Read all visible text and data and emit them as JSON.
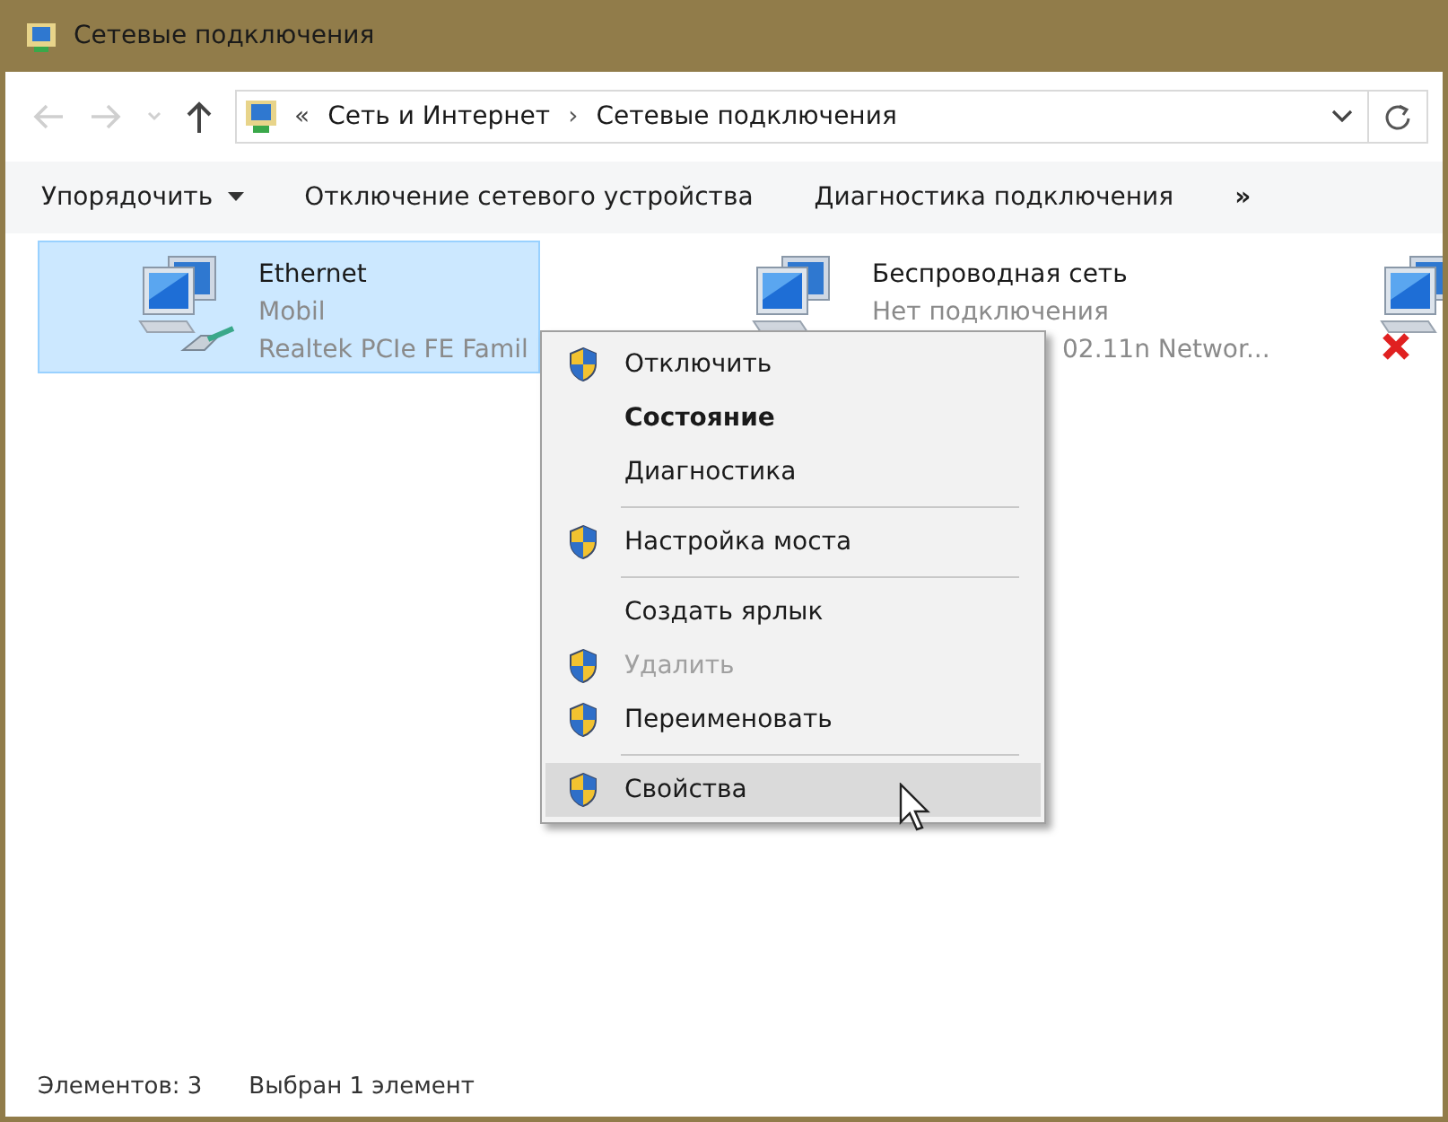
{
  "window": {
    "title": "Сетевые подключения"
  },
  "address_bar": {
    "overflow": "«",
    "path": [
      {
        "label": "Сеть и Интернет",
        "separator": "›"
      },
      {
        "label": "Сетевые подключения"
      }
    ]
  },
  "command_bar": {
    "items": [
      {
        "label": "Упорядочить",
        "dropdown": true
      },
      {
        "label": "Отключение сетевого устройства",
        "dropdown": false
      },
      {
        "label": "Диагностика подключения",
        "dropdown": false
      }
    ],
    "more": "»"
  },
  "connections": [
    {
      "kind": "ethernet",
      "name": "Ethernet",
      "status": "Mobil",
      "device": "Realtek PCIe FE Famil",
      "selected": true
    },
    {
      "kind": "wireless",
      "name": "Беспроводная сеть",
      "status": "Нет подключения",
      "device": "02.11n Networ...",
      "selected": false
    },
    {
      "kind": "disconnected",
      "selected": false
    }
  ],
  "context_menu": {
    "items": [
      {
        "kind": "shield",
        "label": "Отключить",
        "bold": false,
        "disabled": false,
        "selected": false
      },
      {
        "kind": "plain",
        "label": "Состояние",
        "bold": true,
        "disabled": false,
        "selected": false
      },
      {
        "kind": "plain",
        "label": "Диагностика",
        "bold": false,
        "disabled": false,
        "selected": false
      },
      {
        "kind": "separator"
      },
      {
        "kind": "shield",
        "label": "Настройка моста",
        "bold": false,
        "disabled": false,
        "selected": false
      },
      {
        "kind": "separator"
      },
      {
        "kind": "plain",
        "label": "Создать ярлык",
        "bold": false,
        "disabled": false,
        "selected": false
      },
      {
        "kind": "shield",
        "label": "Удалить",
        "bold": false,
        "disabled": true,
        "selected": false
      },
      {
        "kind": "shield",
        "label": "Переименовать",
        "bold": false,
        "disabled": false,
        "selected": false
      },
      {
        "kind": "separator"
      },
      {
        "kind": "shield",
        "label": "Свойства",
        "bold": false,
        "disabled": false,
        "selected": true
      }
    ]
  },
  "status_bar": {
    "items": [
      "Элементов: 3",
      "Выбран 1 элемент"
    ]
  }
}
